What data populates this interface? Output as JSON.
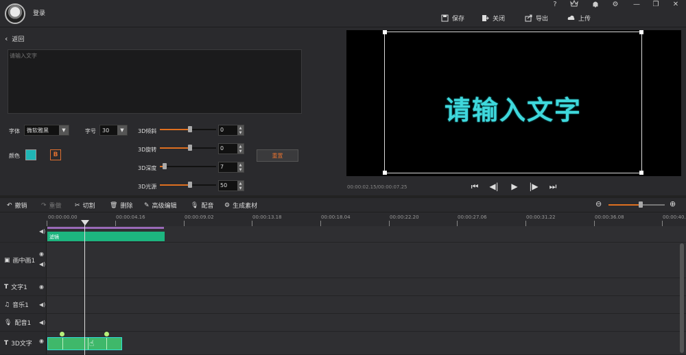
{
  "app": {
    "login_label": "登录"
  },
  "window_controls": [
    "?",
    "♕",
    "🔔",
    "⚙",
    "—",
    "❐",
    "✕"
  ],
  "top_actions": {
    "save": "保存",
    "close": "关闭",
    "export": "导出",
    "upload": "上传"
  },
  "editor": {
    "back_label": "返回",
    "text_placeholder": "请输入文字",
    "font_label": "字体",
    "font_value": "微软雅黑",
    "size_label": "字号",
    "size_value": "30",
    "color_label": "颜色",
    "color_value": "#1fb5b5",
    "bold_label": "B",
    "sliders": [
      {
        "label": "3D倾斜",
        "value": "0",
        "level": 0.5
      },
      {
        "label": "3D旋转",
        "value": "0",
        "level": 0.5
      },
      {
        "label": "3D深度",
        "value": "7",
        "level": 0.07
      },
      {
        "label": "3D光源",
        "value": "50",
        "level": 0.5
      }
    ],
    "reset_label": "重置"
  },
  "preview": {
    "text": "请输入文字",
    "timecode": "00:00:02.15/00:00:07.25"
  },
  "toolbar": {
    "undo": "撤销",
    "redo": "重做",
    "cut": "切割",
    "delete": "删除",
    "advanced": "高级编辑",
    "dub": "配音",
    "generate": "生成素材",
    "zoom_level": 0.7
  },
  "ruler": {
    "labels": [
      "00:00:00.00",
      "00:00:04.16",
      "00:00:09.02",
      "00:00:13.18",
      "00:00:18.04",
      "00:00:22.20",
      "00:00:27.06",
      "00:00:31.22",
      "00:00:36.08",
      "00:00:40."
    ]
  },
  "tracks": {
    "video_clip_label": "滤镜",
    "pip": "画中画1",
    "text": "文字1",
    "music": "音乐1",
    "dub": "配音1",
    "text3d": "3D文字"
  },
  "colors": {
    "accent": "#e07020",
    "clip_green": "#1db57f",
    "text3d": "#3fd8dc"
  }
}
